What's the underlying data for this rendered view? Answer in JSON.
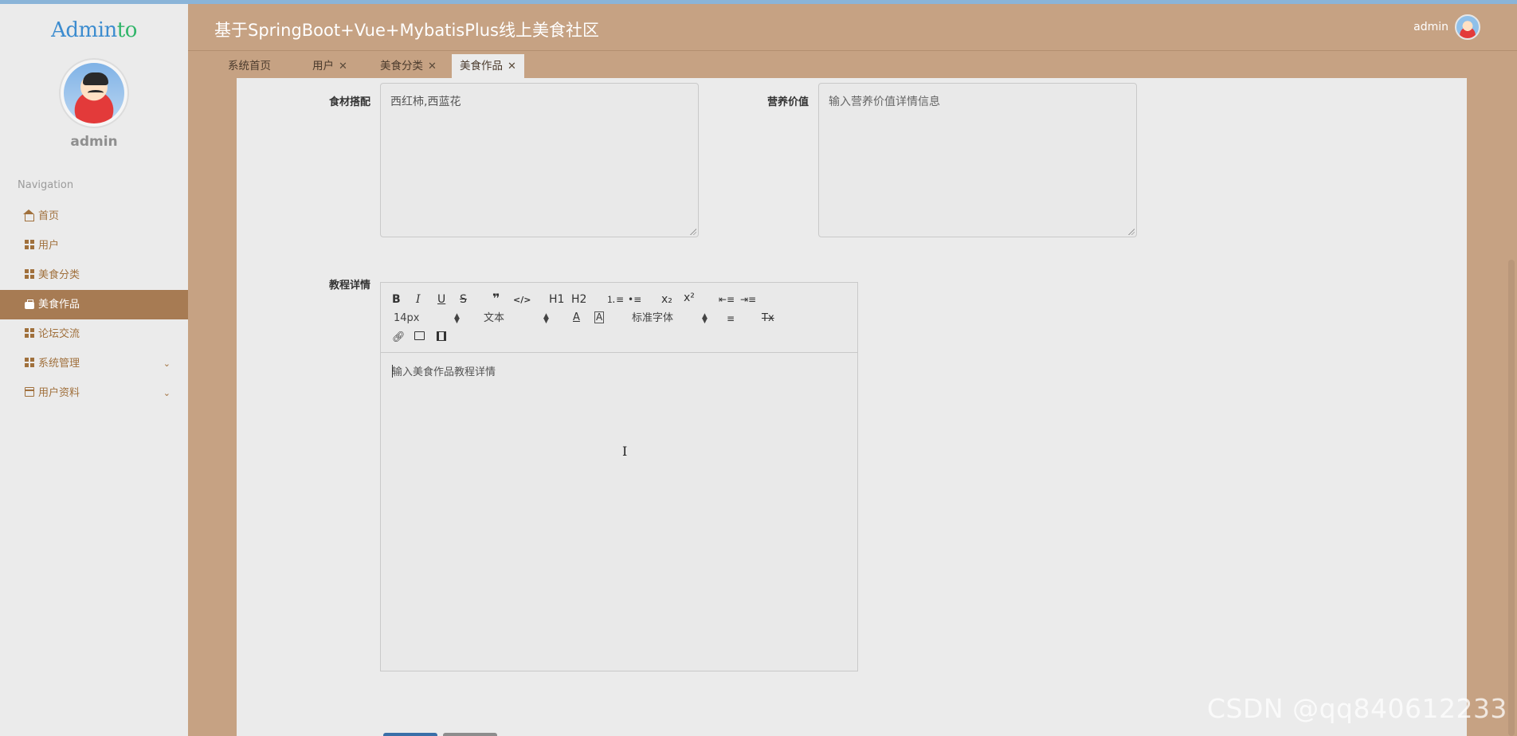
{
  "sidebar": {
    "logo_main": "Admin",
    "logo_accent": "to",
    "user_name": "admin",
    "nav_heading": "Navigation",
    "items": [
      {
        "label": "首页",
        "icon": "home-icon"
      },
      {
        "label": "用户",
        "icon": "grid-icon"
      },
      {
        "label": "美食分类",
        "icon": "grid-icon"
      },
      {
        "label": "美食作品",
        "icon": "briefcase-icon",
        "active": true
      },
      {
        "label": "论坛交流",
        "icon": "grid-icon"
      },
      {
        "label": "系统管理",
        "icon": "grid-icon",
        "expandable": true
      },
      {
        "label": "用户资料",
        "icon": "card-icon",
        "expandable": true
      }
    ]
  },
  "header": {
    "title": "基于SpringBoot+Vue+MybatisPlus线上美食社区",
    "user_name": "admin"
  },
  "tabs": [
    {
      "label": "系统首页",
      "closable": false
    },
    {
      "label": "用户",
      "closable": true
    },
    {
      "label": "美食分类",
      "closable": true
    },
    {
      "label": "美食作品",
      "closable": true,
      "active": true
    }
  ],
  "form": {
    "ingredients_label": "食材搭配",
    "ingredients_value": "西红柿,西蓝花",
    "nutrition_label": "营养价值",
    "nutrition_placeholder": "输入营养价值详情信息",
    "tutorial_label": "教程详情",
    "tutorial_placeholder": "输入美食作品教程详情"
  },
  "editor_toolbar": {
    "bold": "B",
    "italic": "I",
    "underline": "U",
    "strike": "S",
    "quote": "❞",
    "code": "</>",
    "h1": "H1",
    "h2": "H2",
    "font_size": "14px",
    "header_select": "文本",
    "font_family": "标准字体",
    "color": "A",
    "background": "A",
    "subscript": "x₂",
    "superscript": "x²",
    "clean": "Tx"
  },
  "watermark": "CSDN @qq840612233",
  "colors": {
    "brand_bg": "#c6a283",
    "active_menu": "#a77b53",
    "menu_text": "#a0703c",
    "panel_bg": "#ebebeb"
  }
}
